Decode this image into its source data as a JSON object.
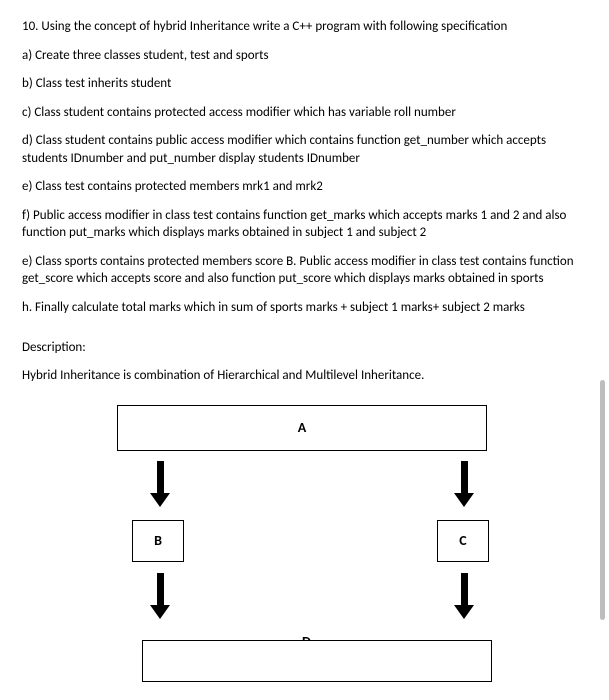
{
  "q_title": "10. Using the concept of hybrid Inheritance write a C++ program with following specification",
  "spec_a": "a) Create three classes student, test and sports",
  "spec_b": "b) Class test inherits student",
  "spec_c": "c) Class student contains protected access modifier which has variable roll number",
  "spec_d": "d) Class student contains public access modifier which contains function get_number which accepts students IDnumber and put_number display students IDnumber",
  "spec_e": "e) Class test contains protected members mrk1 and mrk2",
  "spec_f": "f) Public access modifier in class test contains function get_marks which accepts marks 1 and 2 and also function put_marks which displays marks obtained in subject 1 and subject 2",
  "spec_e2": "e) Class sports contains protected members score B. Public access modifier in class test contains function get_score which accepts score and also function put_score which displays marks obtained in sports",
  "spec_h": "h. Finally calculate total marks which in sum of sports marks + subject 1 marks+ subject 2 marks",
  "desc_label": "Description:",
  "desc_text": "Hybrid Inheritance is combination of Hierarchical and Multilevel Inheritance.",
  "diagram": {
    "a": "A",
    "b": "B",
    "c": "C",
    "d": "D"
  }
}
